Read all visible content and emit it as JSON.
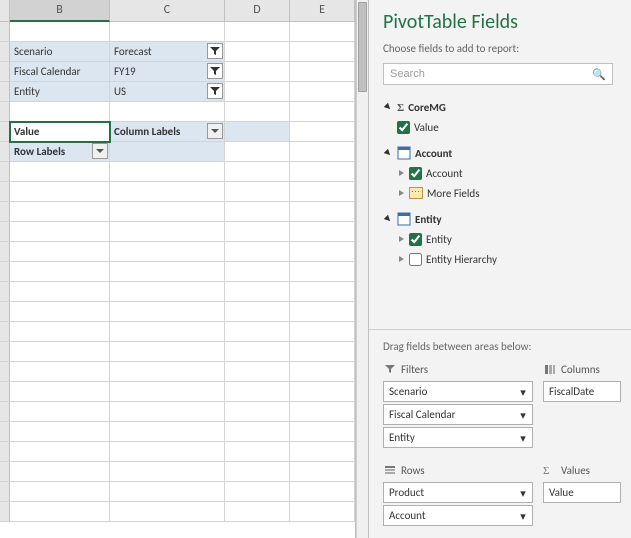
{
  "columns": [
    "B",
    "C",
    "D",
    "E"
  ],
  "filters": {
    "scenario": {
      "label": "Scenario",
      "value": "Forecast"
    },
    "fiscal": {
      "label": "Fiscal Calendar",
      "value": "FY19"
    },
    "entity": {
      "label": "Entity",
      "value": "US"
    }
  },
  "pivot": {
    "value_label": "Value",
    "col_labels": "Column Labels",
    "row_labels": "Row Labels"
  },
  "panel": {
    "title": "PivotTable Fields",
    "subtitle": "Choose fields to add to report:",
    "search_placeholder": "Search"
  },
  "field_groups": {
    "coremg": {
      "name": "CoreMG",
      "items": [
        {
          "label": "Value",
          "checked": true
        }
      ]
    },
    "account": {
      "name": "Account",
      "items": [
        {
          "label": "Account",
          "checked": true,
          "expandable": true
        },
        {
          "label": "More Fields",
          "more": true
        }
      ]
    },
    "entity": {
      "name": "Entity",
      "items": [
        {
          "label": "Entity",
          "checked": true,
          "expandable": true
        },
        {
          "label": "Entity Hierarchy",
          "checked": false,
          "expandable": true
        }
      ]
    }
  },
  "drag_label": "Drag fields between areas below:",
  "areas": {
    "filters": {
      "title": "Filters",
      "items": [
        "Scenario",
        "Fiscal Calendar",
        "Entity"
      ]
    },
    "columns": {
      "title": "Columns",
      "items": [
        "FiscalDate"
      ]
    },
    "rows": {
      "title": "Rows",
      "items": [
        "Product",
        "Account"
      ]
    },
    "values": {
      "title": "Values",
      "items": [
        "Value"
      ]
    }
  }
}
